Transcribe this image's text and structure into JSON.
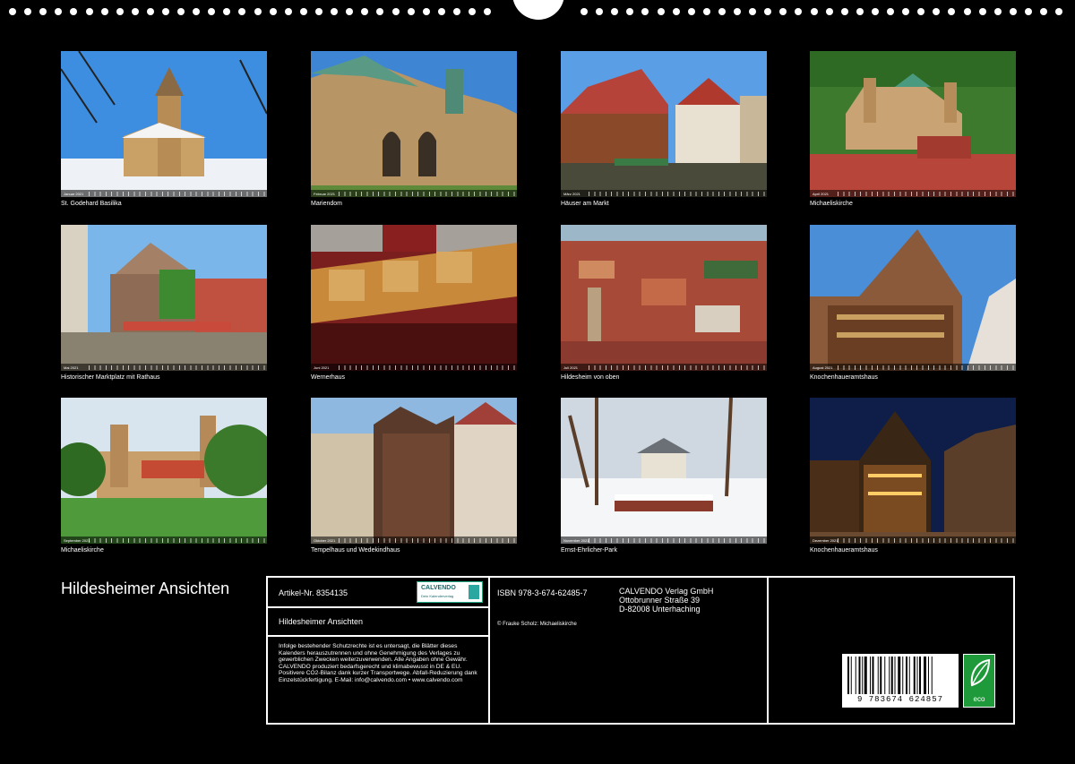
{
  "thumbnails": [
    {
      "caption": "St. Godehard Basilika",
      "month": "Januar 2021",
      "scene": "basilica-winter"
    },
    {
      "caption": "Mariendom",
      "month": "Februar 2021",
      "scene": "cathedral"
    },
    {
      "caption": "Häuser am Markt",
      "month": "März 2021",
      "scene": "market-houses"
    },
    {
      "caption": "Michaeliskirche",
      "month": "April 2021",
      "scene": "church-aerial"
    },
    {
      "caption": "Historischer Marktplatz mit Rathaus",
      "month": "Mai 2021",
      "scene": "town-hall"
    },
    {
      "caption": "Wernerhaus",
      "month": "Juni 2021",
      "scene": "carved-facade"
    },
    {
      "caption": "Hildesheim von oben",
      "month": "Juli 2021",
      "scene": "city-aerial"
    },
    {
      "caption": "Knochenhaueramtshaus",
      "month": "August 2021",
      "scene": "timber-house"
    },
    {
      "caption": "Michaeliskirche",
      "month": "September 2021",
      "scene": "church-lawn"
    },
    {
      "caption": "Tempelhaus und Wedekindhaus",
      "month": "Oktober 2021",
      "scene": "tempelhaus"
    },
    {
      "caption": "Ernst-Ehrlicher-Park",
      "month": "November 2021",
      "scene": "park-winter"
    },
    {
      "caption": "Knochenhaueramtshaus",
      "month": "Dezember 2021",
      "scene": "timber-night"
    }
  ],
  "title": "Hildesheimer Ansichten",
  "info": {
    "article": "Artikel-Nr. 8354135",
    "logo": {
      "name": "CALVENDO",
      "slogan": "Dein Kalenderverlag"
    },
    "work_title": "Hildesheimer Ansichten",
    "legal": "Infolge bestehender Schutzrechte ist es untersagt, die Blätter dieses Kalenders herauszutrennen und ohne Genehmigung des Verlages zu gewerblichen Zwecken weiterzuverwenden. Alle Angaben ohne Gewähr. CALVENDO produziert bedarfsgerecht und klimabewusst in DE & EU. Positivere CO2-Bilanz dank kurzer Transportwege. Abfall-Reduzierung dank Einzelstückfertigung. E-Mail: info@calvendo.com • www.calvendo.com",
    "isbn": "ISBN 978-3-674-62485-7",
    "copyright": "© Frauke Scholz: Michaeliskirche",
    "publisher": [
      "CALVENDO Verlag GmbH",
      "Ottobrunner Straße 39",
      "D-82008 Unterhaching"
    ],
    "barcode_number": "9 783674 624857",
    "eco_label": "eco"
  },
  "colors": {
    "background": "#000000",
    "eco_green": "#1f9a3a",
    "calvendo_teal": "#2aa7a0"
  }
}
